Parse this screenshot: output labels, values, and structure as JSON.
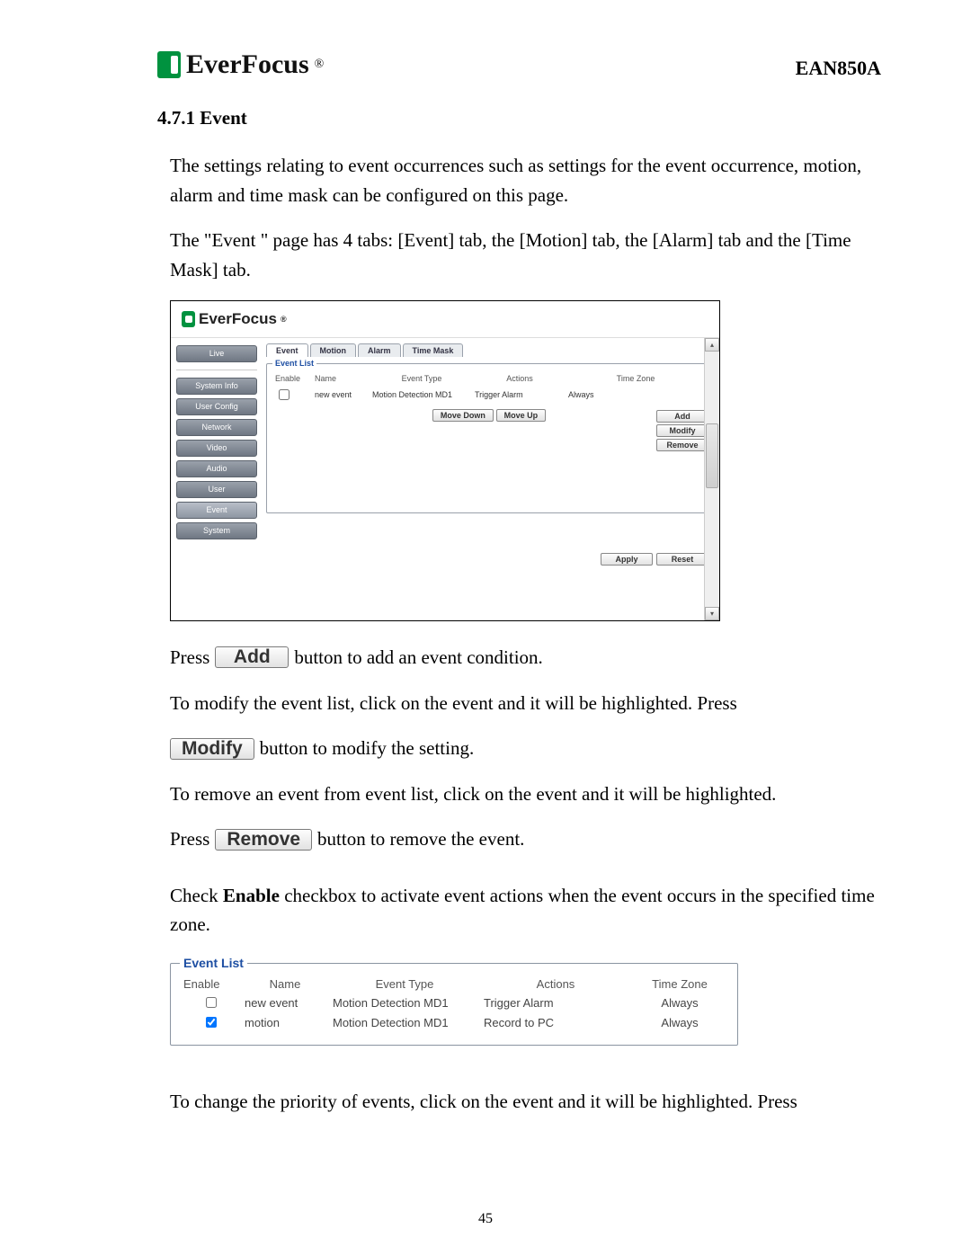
{
  "brand": "EverFocus",
  "model": "EAN850A",
  "section_heading": "4.7.1 Event",
  "intro_p1": "The settings relating to event occurrences such as settings for the event occurrence, motion, alarm and time mask can be configured on this page.",
  "intro_p2": "The \"Event \" page has 4 tabs: [Event] tab, the [Motion] tab, the [Alarm] tab and the [Time Mask] tab.",
  "shot": {
    "nav": {
      "live": "Live",
      "system_info": "System Info",
      "user_config": "User Config",
      "network": "Network",
      "video": "Video",
      "audio": "Audio",
      "user": "User",
      "event": "Event",
      "system": "System"
    },
    "tabs": {
      "event": "Event",
      "motion": "Motion",
      "alarm": "Alarm",
      "time_mask": "Time Mask"
    },
    "list_legend": "Event List",
    "headers": {
      "enable": "Enable",
      "name": "Name",
      "type": "Event Type",
      "actions": "Actions",
      "tz": "Time Zone"
    },
    "row1": {
      "name": "new event",
      "type": "Motion Detection MD1",
      "actions": "Trigger Alarm",
      "tz": "Always"
    },
    "side": {
      "add": "Add",
      "modify": "Modify",
      "remove": "Remove"
    },
    "move": {
      "down": "Move Down",
      "up": "Move Up"
    },
    "apply": "Apply",
    "reset": "Reset"
  },
  "text_press": "Press",
  "btn_add": "Add",
  "text_after_add": "button to add an event condition.",
  "text_modify_line": "To modify the event list, click on the event and it will be highlighted. Press",
  "btn_modify": "Modify",
  "text_after_modify": "button to modify the setting.",
  "text_remove_intro": "To remove an event from event list, click on the event and it will be highlighted.",
  "btn_remove": "Remove",
  "text_after_remove": "button to remove the event.",
  "enable_pre": "Check ",
  "enable_bold": "Enable",
  "enable_post": " checkbox to activate event actions when the event occurs in the specified time zone.",
  "large_list": {
    "legend": "Event List",
    "headers": {
      "enable": "Enable",
      "name": "Name",
      "type": "Event Type",
      "actions": "Actions",
      "tz": "Time Zone"
    },
    "rows": [
      {
        "checked": false,
        "name": "new event",
        "type": "Motion Detection MD1",
        "actions": "Trigger Alarm",
        "tz": "Always"
      },
      {
        "checked": true,
        "name": "motion",
        "type": "Motion Detection MD1",
        "actions": "Record to PC",
        "tz": "Always"
      }
    ]
  },
  "priority_line": "To change the priority of events, click on the event and it will be highlighted. Press",
  "page_number": "45"
}
